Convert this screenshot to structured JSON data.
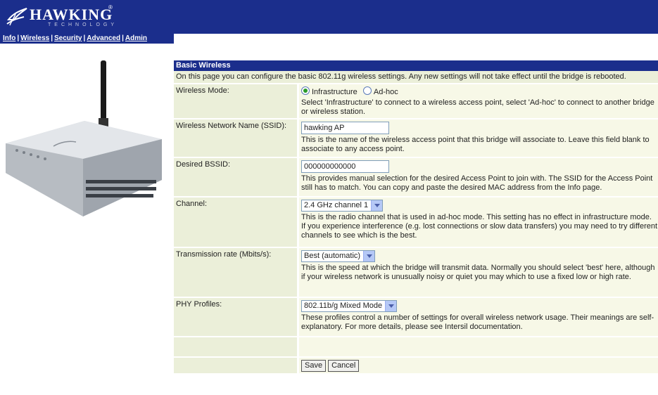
{
  "brand": {
    "name": "HAWKING",
    "sub": "TECHNOLOGY",
    "reg": "®",
    "color": "#1b2e8c"
  },
  "nav": {
    "items": [
      "Info",
      "Wireless",
      "Security",
      "Advanced",
      "Admin"
    ],
    "separator": "|"
  },
  "page": {
    "title": "Basic Wireless",
    "intro": "On this page you can configure the basic 802.11g wireless settings. Any new settings will not take effect until the bridge is rebooted."
  },
  "fields": {
    "mode": {
      "label": "Wireless Mode:",
      "options": [
        "Infrastructure",
        "Ad-hoc"
      ],
      "selected": "Infrastructure",
      "desc": "Select 'Infrastructure' to connect to a wireless access point, select 'Ad-hoc' to connect to another bridge or wireless station."
    },
    "ssid": {
      "label": "Wireless Network Name (SSID):",
      "value": "hawking AP",
      "desc": "This is the name of the wireless access point that this bridge will associate to. Leave this field blank to associate to any access point."
    },
    "bssid": {
      "label": "Desired BSSID:",
      "value": "000000000000",
      "desc": "This provides manual selection for the desired Access Point to join with. The SSID for the Access Point still has to match. You can copy and paste the desired MAC address from the Info page."
    },
    "channel": {
      "label": "Channel:",
      "value": "2.4 GHz channel 1",
      "desc": "This is the radio channel that is used in ad-hoc mode. This setting has no effect in infrastructure mode. If you experience interference (e.g. lost connections or slow data transfers) you may need to try different channels to see which is the best."
    },
    "rate": {
      "label": "Transmission rate (Mbits/s):",
      "value": "Best (automatic)",
      "desc": "This is the speed at which the bridge will transmit data. Normally you should select 'best' here, although if your wireless network is unusually noisy or quiet you may which to use a fixed low or high rate."
    },
    "phy": {
      "label": "PHY Profiles:",
      "value": "802.11b/g Mixed Mode",
      "desc": "These profiles control a number of settings for overall wireless network usage. Their meanings are self-explanatory. For more details, please see Intersil documentation."
    }
  },
  "buttons": {
    "save": "Save",
    "cancel": "Cancel"
  }
}
